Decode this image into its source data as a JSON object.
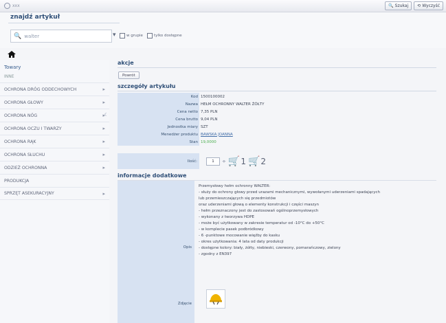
{
  "topbar": {
    "left_text": "xxx",
    "buttons": [
      {
        "label": "Szukaj",
        "icon": "search-icon"
      },
      {
        "label": "Wyczyść",
        "icon": "clear-icon"
      }
    ]
  },
  "search": {
    "title": "znajdź artykuł",
    "value": "walter",
    "placeholder": "",
    "options": [
      {
        "label": "w grupie"
      },
      {
        "label": "tylko dostępne"
      }
    ]
  },
  "sidebar": {
    "header": "Towary",
    "subheader": "INNE",
    "items": [
      {
        "label": "OCHRONA DRÓG ODDECHOWYCH"
      },
      {
        "label": "OCHRONA GŁOWY"
      },
      {
        "label": "OCHRONA NÓG"
      },
      {
        "label": "OCHRONA OCZU I TWARZY"
      },
      {
        "label": "OCHRONA RĄK"
      },
      {
        "label": "OCHRONA SŁUCHU"
      },
      {
        "label": "ODZIEŻ OCHRONNA"
      },
      {
        "label": "PRODUKCJA"
      },
      {
        "label": "SPRZĘT ASEKURACYJNY"
      }
    ]
  },
  "actions": {
    "title": "akcje",
    "back_label": "Powrót"
  },
  "details": {
    "title": "szczegóły artykułu",
    "rows": [
      {
        "label": "Kod",
        "value": "1500100002"
      },
      {
        "label": "Nazwa",
        "value": "HEŁM OCHRONNY WALTER ŻÓŁTY"
      },
      {
        "label": "Cena netto",
        "value": "7,35 PLN"
      },
      {
        "label": "Cena brutto",
        "value": "9,04 PLN"
      },
      {
        "label": "Jednostka miary",
        "value": "SZT"
      },
      {
        "label": "Menedżer produktu",
        "value": "BAWSKA JOANNA"
      },
      {
        "label": "Stan",
        "value": "19,0000"
      }
    ],
    "qty_label": "Ilość:",
    "qty_value": "1",
    "cart1_label": "1",
    "cart2_label": "2"
  },
  "info": {
    "title": "informacje dodatkowe",
    "desc_label": "Opis",
    "photo_label": "Zdjęcie",
    "description": [
      "Przemysłowy hełm ochronny WALTER:",
      "- służy do ochrony głowy przed urazami mechanicznymi, wywołanymi uderzeniami spadających",
      "lub przemieszczających się przedmiotów",
      "oraz uderzeniami głową o elementy konstrukcji i części maszyn",
      "- hełm przeznaczony jest do zastosowań ogólnoprzemysłowych",
      "- wykonany z tworzywa HDPE",
      "- może być użytkowany w zakresie temperatur od -10°C do +50°C",
      "- w komplecie pasek podbródkowy",
      "- 6 -punktowe mocowanie więźby do kasku",
      "- okres użytkowania: 4 lata od daty produkcji",
      "- dostępne kolory: biały, żółty, niebieski, czerwony, pomarańczowy, zielony",
      "- zgodny z EN397"
    ]
  }
}
